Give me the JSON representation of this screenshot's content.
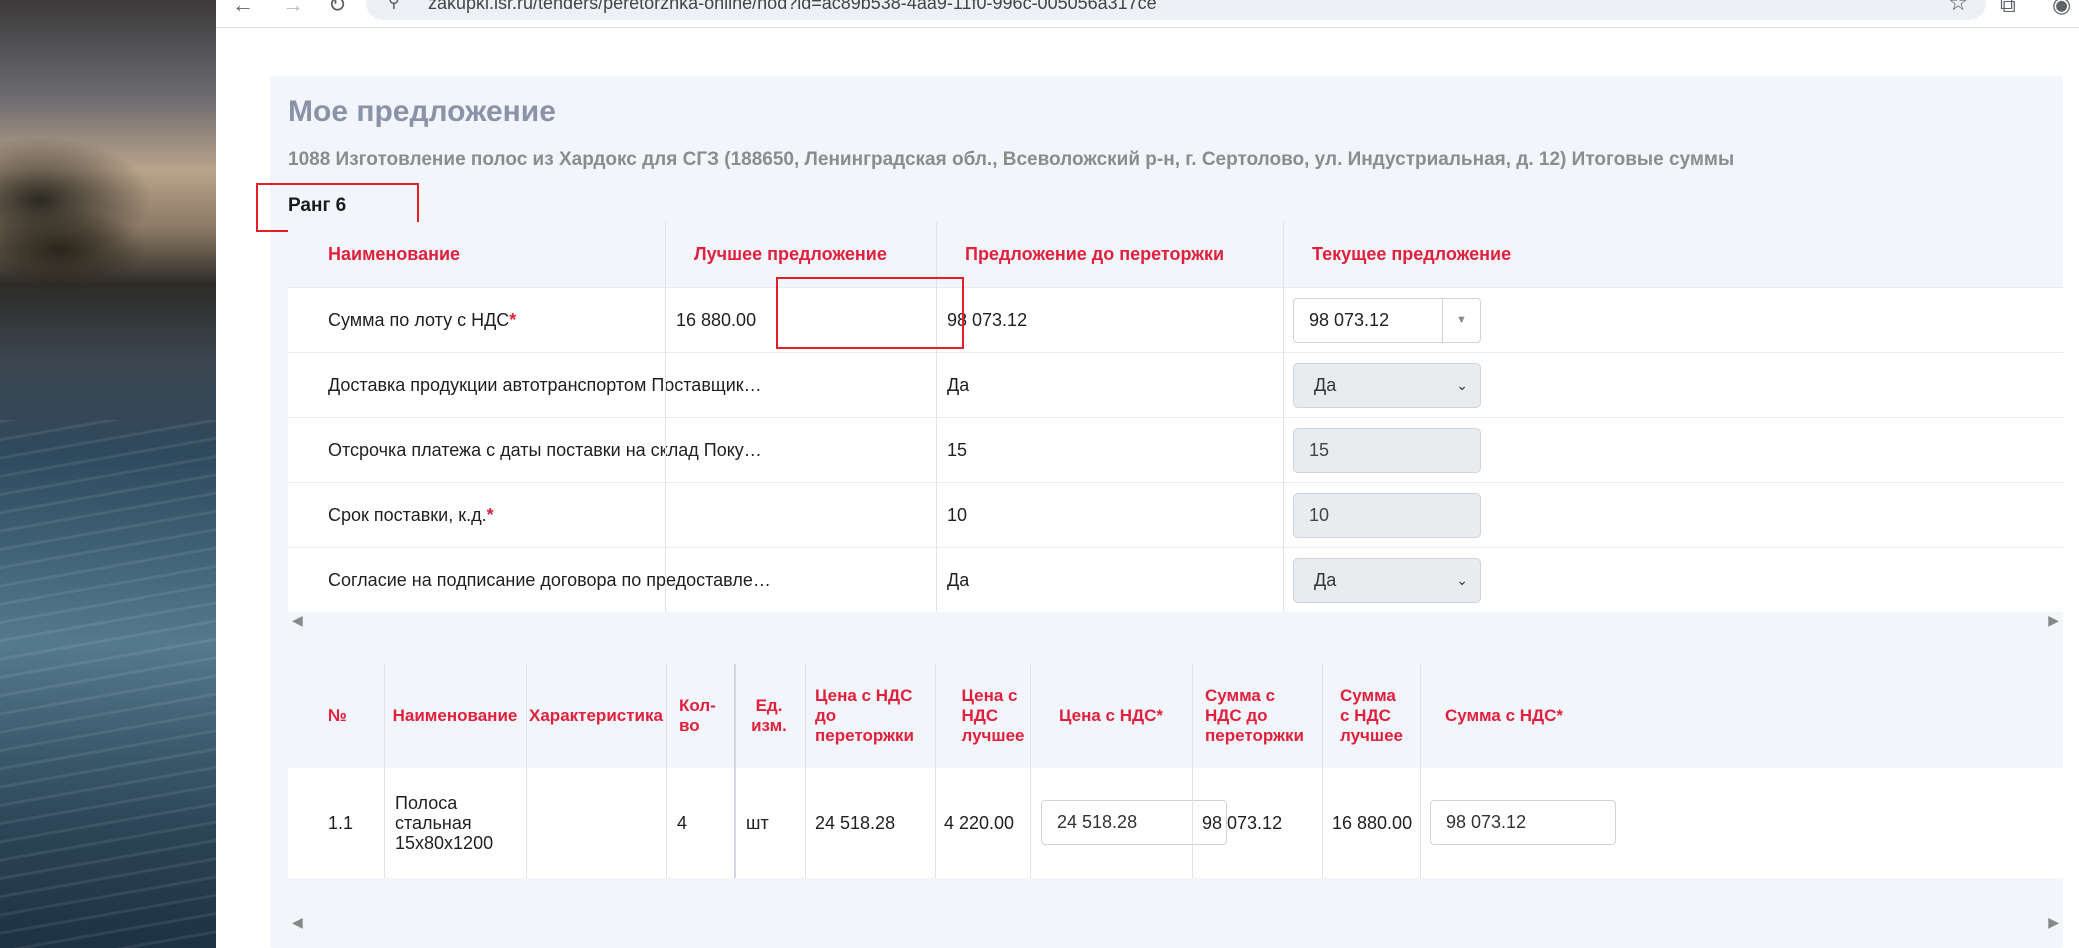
{
  "browser": {
    "url": "zakupki.lsr.ru/tenders/peretorzhka-online/nod?id=ac89b538-4aa9-11f0-996c-005056a317ce"
  },
  "page": {
    "title": "Мое предложение",
    "subtitle": "1088 Изготовление полос из Хардокс для СГЗ (188650, Ленинградская обл., Всеволожский р-н, г. Сертолово, ул. Индустриальная, д. 12) Итоговые суммы",
    "rank": "Ранг 6"
  },
  "summary_table": {
    "headers": {
      "name": "Наименование",
      "best": "Лучшее предложение",
      "before": "Предложение до переторжки",
      "current": "Текущее предложение"
    },
    "rows": [
      {
        "name": "Сумма по лоту с НДС",
        "required": "*",
        "best": "16 880.00",
        "before": "98 073.12",
        "current": "98 073.12"
      },
      {
        "name": "Доставка продукции автотранспортом Поставщик…",
        "required": "",
        "best": "",
        "before": "Да",
        "current": "Да"
      },
      {
        "name": "Отсрочка платежа с даты поставки на склад Поку…",
        "required": "",
        "best": "",
        "before": "15",
        "current": "15"
      },
      {
        "name": "Срок поставки, к.д.",
        "required": "*",
        "best": "",
        "before": "10",
        "current": "10"
      },
      {
        "name": "Согласие на подписание договора по предоставле…",
        "required": "",
        "best": "",
        "before": "Да",
        "current": "Да"
      }
    ]
  },
  "items_table": {
    "headers": {
      "num": "№",
      "name": "Наименование",
      "char": "Характеристика",
      "qty": "Кол-во",
      "unit": "Ед. изм.",
      "price_before": "Цена с НДС до переторжки",
      "price_best": "Цена с НДС лучшее",
      "price": "Цена с НДС",
      "sum_before": "Сумма с НДС до переторжки",
      "sum_best": "Сумма с НДС лучшее",
      "sum": "Сумма с НДС",
      "required": "*"
    },
    "rows": [
      {
        "num": "1.1",
        "name": "Полоса стальная 15х80х1200",
        "char": "",
        "qty": "4",
        "unit": "шт",
        "price_before": "24 518.28",
        "price_best": "4 220.00",
        "price": "24 518.28",
        "sum_before": "98 073.12",
        "sum_best": "16 880.00",
        "sum": "98 073.12"
      }
    ]
  },
  "colors": {
    "accent": "#e0203c",
    "highlight_box": "#e0202a",
    "panel_bg": "#f2f5f9"
  }
}
